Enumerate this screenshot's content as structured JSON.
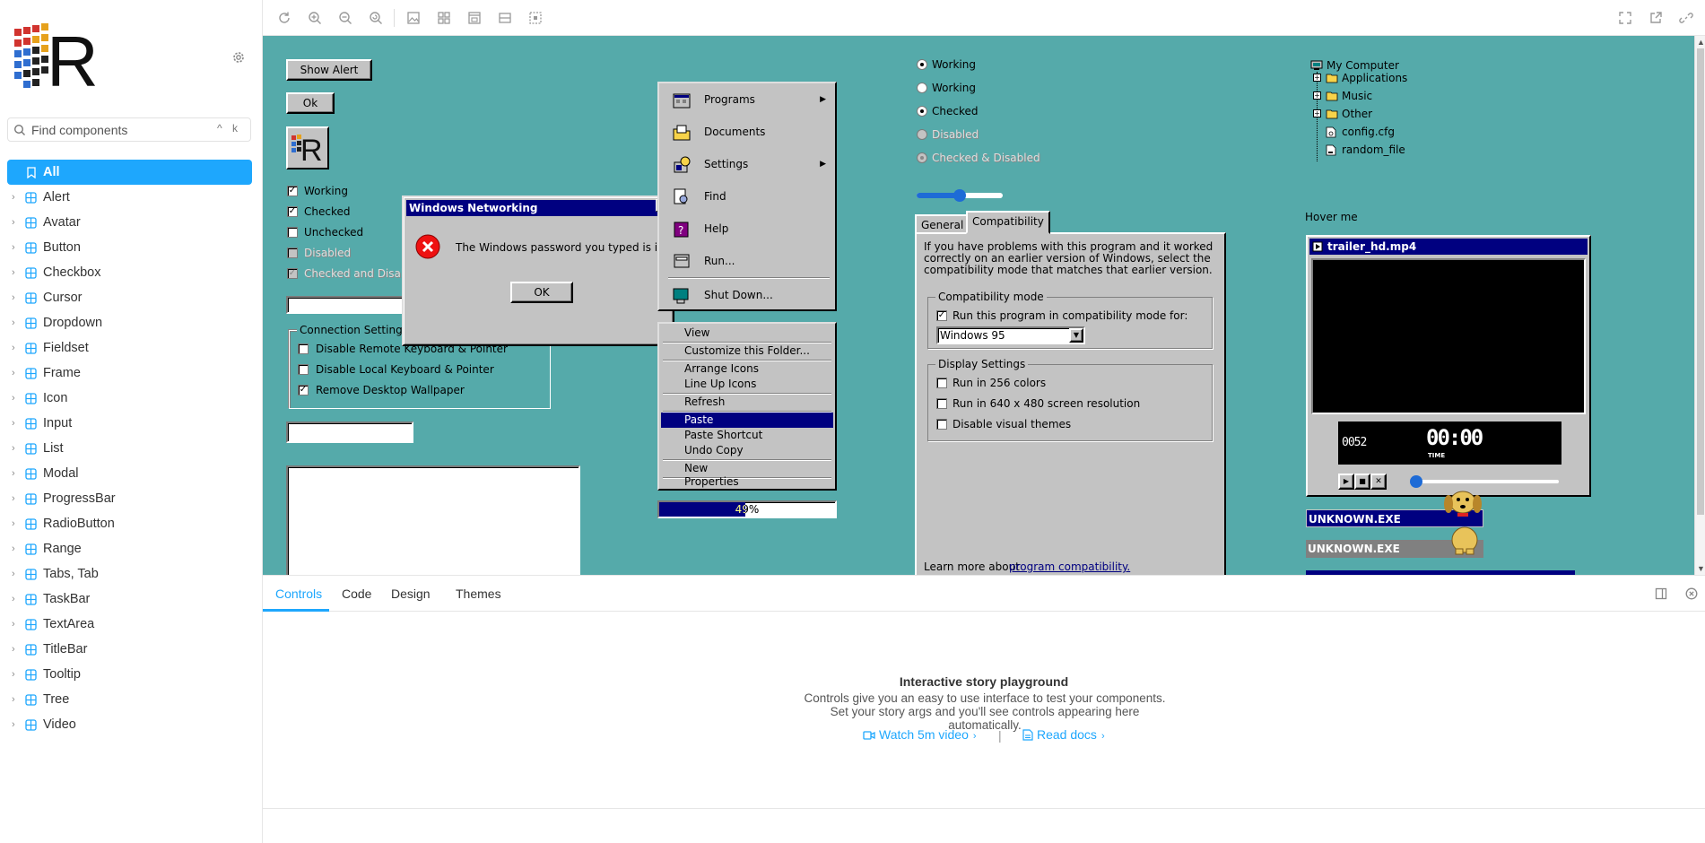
{
  "sidebar": {
    "search_placeholder": "Find components",
    "search_shortcut": "^ k",
    "items": [
      {
        "label": "All",
        "active": true
      },
      {
        "label": "Alert"
      },
      {
        "label": "Avatar"
      },
      {
        "label": "Button"
      },
      {
        "label": "Checkbox"
      },
      {
        "label": "Cursor"
      },
      {
        "label": "Dropdown"
      },
      {
        "label": "Fieldset"
      },
      {
        "label": "Frame"
      },
      {
        "label": "Icon"
      },
      {
        "label": "Input"
      },
      {
        "label": "List"
      },
      {
        "label": "Modal"
      },
      {
        "label": "ProgressBar"
      },
      {
        "label": "RadioButton"
      },
      {
        "label": "Range"
      },
      {
        "label": "Tabs, Tab"
      },
      {
        "label": "TaskBar"
      },
      {
        "label": "TextArea"
      },
      {
        "label": "TitleBar"
      },
      {
        "label": "Tooltip"
      },
      {
        "label": "Tree"
      },
      {
        "label": "Video"
      }
    ]
  },
  "toolbar": {
    "left_icons": [
      "reload-icon",
      "zoom-in-icon",
      "zoom-out-icon",
      "zoom-reset-icon",
      "background-icon",
      "grid-icon",
      "viewport-icon",
      "measure-icon",
      "outline-icon"
    ],
    "right_icons": [
      "fullscreen-icon",
      "open-new-tab-icon",
      "copy-link-icon"
    ]
  },
  "canvas": {
    "show_alert_label": "Show Alert",
    "ok_label": "Ok",
    "checkboxes": [
      {
        "label": "Working",
        "checked": true,
        "disabled": false
      },
      {
        "label": "Checked",
        "checked": true,
        "disabled": false
      },
      {
        "label": "Unchecked",
        "checked": false,
        "disabled": false
      },
      {
        "label": "Disabled",
        "checked": false,
        "disabled": true
      },
      {
        "label": "Checked and Disabled",
        "checked": true,
        "disabled": true
      }
    ],
    "fieldset": {
      "legend": "Connection Settings",
      "options": [
        {
          "label": "Disable Remote Keyboard & Pointer",
          "checked": false
        },
        {
          "label": "Disable Local Keyboard & Pointer",
          "checked": false
        },
        {
          "label": "Remove Desktop Wallpaper",
          "checked": true
        }
      ]
    },
    "modal": {
      "title": "Windows Networking",
      "message": "The Windows password you typed is incorrect.",
      "ok": "OK"
    },
    "start_menu": [
      {
        "label": "Programs",
        "submenu": true
      },
      {
        "label": "Documents",
        "submenu": false
      },
      {
        "label": "Settings",
        "submenu": true
      },
      {
        "label": "Find",
        "submenu": false
      },
      {
        "label": "Help",
        "submenu": false
      },
      {
        "label": "Run...",
        "submenu": false
      },
      {
        "label": "Shut Down...",
        "submenu": false
      }
    ],
    "context_menu": [
      "View",
      "Customize this Folder...",
      "Arrange Icons",
      "Line Up Icons",
      "Refresh",
      "Paste",
      "Paste Shortcut",
      "Undo Copy",
      "New",
      "Properties"
    ],
    "context_selected": "Paste",
    "progress": {
      "value": 0.49,
      "label": "49%"
    },
    "radios": [
      {
        "label": "Working",
        "checked": true,
        "disabled": false
      },
      {
        "label": "Working",
        "checked": false,
        "disabled": false
      },
      {
        "label": "Checked",
        "checked": true,
        "disabled": false
      },
      {
        "label": "Disabled",
        "checked": false,
        "disabled": true
      },
      {
        "label": "Checked & Disabled",
        "checked": true,
        "disabled": true
      }
    ],
    "range": {
      "value": 0.5
    },
    "tabs": {
      "items": [
        "General",
        "Compatibility"
      ],
      "active": "Compatibility",
      "description": "If you have problems with this program and it worked correctly on an earlier version of Windows, select the compatibility mode that matches that earlier version.",
      "compat_legend": "Compatibility mode",
      "compat_checkbox": "Run this program in compatibility mode for:",
      "compat_select": "Windows 95",
      "display_legend": "Display Settings",
      "display_options": [
        "Run in 256 colors",
        "Run in 640 x 480 screen resolution",
        "Disable visual themes"
      ],
      "learn_prefix": "Learn more about",
      "learn_link": "program compatibility."
    },
    "tree": {
      "root": "My Computer",
      "children": [
        {
          "label": "Applications",
          "type": "folder"
        },
        {
          "label": "Music",
          "type": "folder"
        },
        {
          "label": "Other",
          "type": "folder"
        },
        {
          "label": "config.cfg",
          "type": "file"
        },
        {
          "label": "random_file",
          "type": "file"
        }
      ]
    },
    "tooltip_hover": "Hover me",
    "video": {
      "title": "trailer_hd.mp4",
      "elapsed": "0052",
      "time": "00:00",
      "time_label": "TIME"
    },
    "taskbar_items": [
      "UNKNOWN.EXE",
      "UNKNOWN.EXE"
    ]
  },
  "panel": {
    "tabs": [
      "Controls",
      "Code",
      "Design",
      "Themes"
    ],
    "active_tab": "Controls",
    "empty_title": "Interactive story playground",
    "empty_desc": "Controls give you an easy to use interface to test your components. Set your story args and you'll see controls appearing here automatically.",
    "watch_video": "Watch 5m video",
    "read_docs": "Read docs",
    "separator": "|"
  },
  "colors": {
    "accent": "#1ea7fd",
    "canvas_bg": "#55aaaa",
    "win_gray": "#c3c3c3",
    "win_blue": "#000080"
  }
}
